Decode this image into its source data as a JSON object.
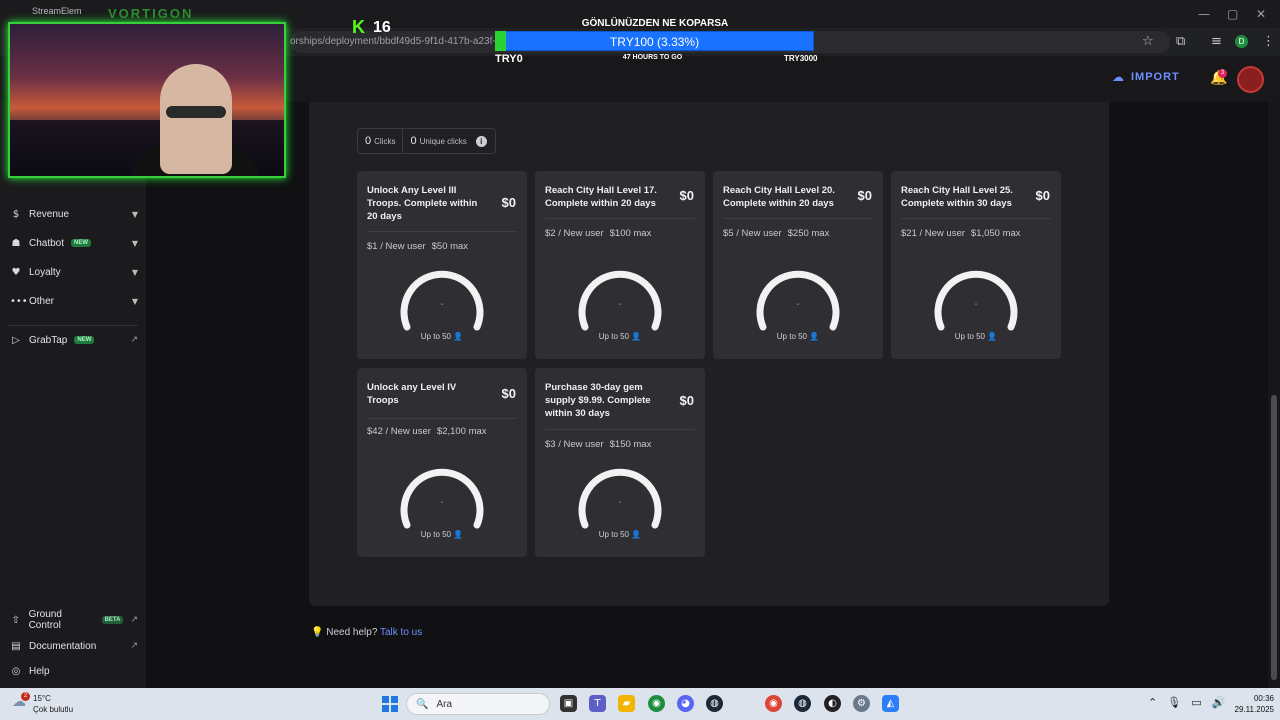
{
  "browser": {
    "url": "orships/deployment/bbdf49d5-9f1d-417b-a23f-6",
    "tab_label": "StreamElem"
  },
  "header": {
    "import_label": "IMPORT",
    "notification_count": "3"
  },
  "sidebar": {
    "items": [
      {
        "label": "Revenue",
        "icon": "dollar-icon"
      },
      {
        "label": "Chatbot",
        "badge": "NEW",
        "icon": "robot-icon"
      },
      {
        "label": "Loyalty",
        "icon": "hand-heart-icon"
      },
      {
        "label": "Other",
        "icon": "dots-icon"
      },
      {
        "label": "GrabTap",
        "badge": "NEW",
        "icon": "grabtap-icon"
      }
    ],
    "footer": [
      {
        "label": "Ground Control",
        "badge": "BETA"
      },
      {
        "label": "Documentation"
      },
      {
        "label": "Help"
      }
    ]
  },
  "stats": {
    "clicks_value": "0",
    "clicks_label": "Clicks",
    "unique_value": "0",
    "unique_label": "Unique clicks"
  },
  "cards": [
    {
      "title": "Unlock Any Level III Troops. Complete within 20 days",
      "amount": "$0",
      "rate": "$1 / New user",
      "max": "$50 max",
      "gauge": "-",
      "cap": "Up to 50"
    },
    {
      "title": "Reach City Hall Level 17. Complete within 20 days",
      "amount": "$0",
      "rate": "$2 / New user",
      "max": "$100 max",
      "gauge": "-",
      "cap": "Up to 50"
    },
    {
      "title": "Reach City Hall Level 20. Complete within 20 days",
      "amount": "$0",
      "rate": "$5 / New user",
      "max": "$250 max",
      "gauge": "-",
      "cap": "Up to 50"
    },
    {
      "title": "Reach City Hall Level 25. Complete within 30 days",
      "amount": "$0",
      "rate": "$21 / New user",
      "max": "$1,050 max",
      "gauge": "-",
      "cap": "Up to 50"
    },
    {
      "title": "Unlock any Level IV Troops",
      "amount": "$0",
      "rate": "$42 / New user",
      "max": "$2,100 max",
      "gauge": "-",
      "cap": "Up to 50"
    },
    {
      "title": "Purchase 30-day gem supply $9.99. Complete within 30 days",
      "amount": "$0",
      "rate": "$3 / New user",
      "max": "$150 max",
      "gauge": "-",
      "cap": "Up to 50"
    }
  ],
  "help": {
    "prefix": "Need help?",
    "link": "Talk to us"
  },
  "overlay": {
    "brand": "VORTIGON",
    "kick_count": "16",
    "goal_title": "GÖNLÜNÜZDEN NE KOPARSA",
    "goal_progress_text": "TRY100 (3.33%)",
    "goal_progress_fraction": 0.0333,
    "goal_min": "TRY0",
    "goal_remaining": "47 HOURS TO GO",
    "goal_max": "TRY3000"
  },
  "taskbar": {
    "weather_temp": "15°C",
    "weather_desc": "Çok bulutlu",
    "weather_badge": "2",
    "search_placeholder": "Ara",
    "time": "00:36",
    "date": "29.11.2025"
  },
  "colors": {
    "accent": "#6f8fff",
    "goal_bar": "#1a73ff",
    "goal_fill": "#2bd236",
    "new_badge": "#1f7a3d"
  }
}
